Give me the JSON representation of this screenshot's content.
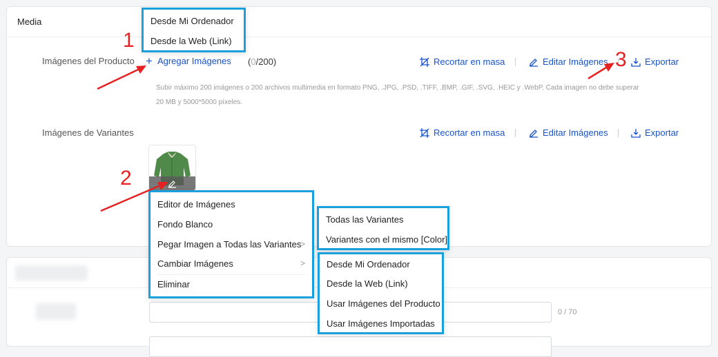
{
  "media": {
    "title": "Media",
    "product_images": {
      "label": "Imágenes del Producto",
      "add_label": "Agregar Imágenes",
      "count_prefix": "(",
      "count_current": "0",
      "count_suffix": "/200)",
      "hint_line1": "Subir máximo 200 imágenes o 200 archivos multimedia en formato PNG, .JPG, .PSD, .TIFF, .BMP, .GIF, .SVG, .HEIC y .WebP. Cada imagen no debe superar",
      "hint_line2": "20 MB y 5000*5000 píxeles."
    },
    "variant_images": {
      "label": "Imágenes de Variantes"
    },
    "actions": {
      "bulk_crop": "Recortar en masa",
      "edit_images": "Editar Imágenes",
      "export": "Exportar"
    }
  },
  "upload_menu": {
    "items": [
      "Desde Mi Ordenador",
      "Desde la Web (Link)"
    ]
  },
  "variant_context_menu": {
    "items": [
      "Editor de Imágenes",
      "Fondo Blanco",
      "Pegar Imagen a Todas las Variantes",
      "Cambiar Imágenes",
      "Eliminar"
    ]
  },
  "paste_submenu": {
    "items": [
      "Todas las Variantes",
      "Variantes con el mismo [Color]"
    ]
  },
  "change_submenu": {
    "items": [
      "Desde Mi Ordenador",
      "Desde la Web (Link)",
      "Usar Imágenes del Producto",
      "Usar Imágenes Importadas"
    ]
  },
  "annotations": [
    "1",
    "2",
    "3"
  ],
  "second_section": {
    "title_counter": "0 / 70"
  },
  "colors": {
    "link": "#1652c9",
    "highlight_border": "#1aa0dc",
    "annotation": "#e52121"
  }
}
